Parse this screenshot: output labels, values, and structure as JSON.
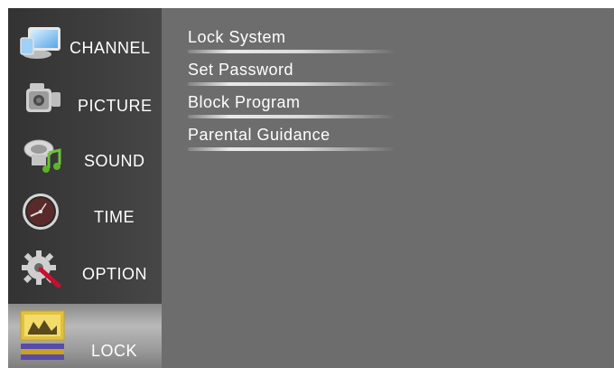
{
  "menu": {
    "items": [
      {
        "label": "CHANNEL",
        "icon": "channel-monitor-icon"
      },
      {
        "label": "PICTURE",
        "icon": "picture-camera-icon"
      },
      {
        "label": "SOUND",
        "icon": "sound-music-icon"
      },
      {
        "label": "TIME",
        "icon": "time-clock-icon"
      },
      {
        "label": "OPTION",
        "icon": "option-gear-icon"
      },
      {
        "label": "LOCK",
        "icon": "lock-icon",
        "selected": true
      }
    ]
  },
  "lock_menu": {
    "options": [
      {
        "label": "Lock System"
      },
      {
        "label": "Set Password"
      },
      {
        "label": "Block Program"
      },
      {
        "label": "Parental Guidance"
      }
    ]
  },
  "colors": {
    "background": "#6d6d6d",
    "sidebar": "#3a3a3a",
    "text": "#ffffff",
    "active_item": "#b9b9b9"
  }
}
